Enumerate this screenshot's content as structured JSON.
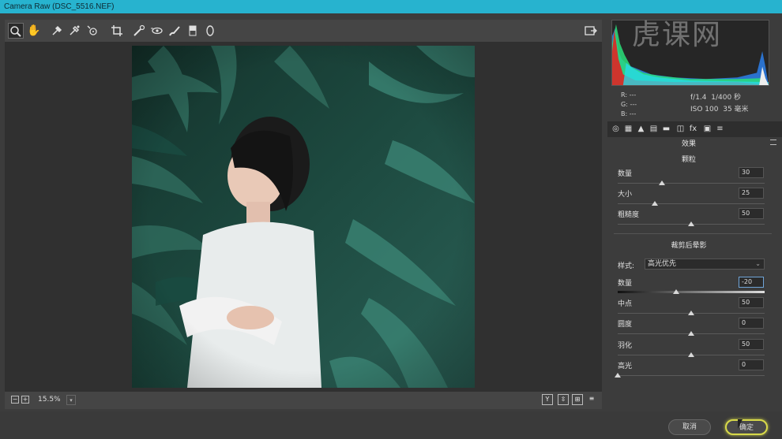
{
  "window": {
    "title": "Camera Raw (DSC_5516.NEF)"
  },
  "toolbar": {
    "tools": [
      "zoom-icon",
      "hand-icon",
      "white-balance-icon",
      "color-sampler-icon",
      "target-adjust-icon",
      "crop-icon",
      "spot-removal-icon",
      "red-eye-icon",
      "adjustment-brush-icon",
      "graduated-filter-icon",
      "radial-filter-icon"
    ],
    "right_tool": "open-preferences-icon"
  },
  "bottom": {
    "zoom_minus": "−",
    "zoom_plus": "+",
    "zoom": "15.5%"
  },
  "view_buttons": [
    "Y",
    "⇳",
    "⊞",
    "≡"
  ],
  "info": {
    "r_label": "R:",
    "g_label": "G:",
    "b_label": "B:",
    "r_val": "---",
    "g_val": "---",
    "b_val": "---",
    "aperture": "f/1.4",
    "shutter": "1/400 秒",
    "iso": "ISO 100",
    "focal": "35 毫米"
  },
  "panel": {
    "section_title": "效果",
    "grain": {
      "title": "颗粒",
      "sliders": [
        {
          "label": "数量",
          "value": "30",
          "pos": 0.3
        },
        {
          "label": "大小",
          "value": "25",
          "pos": 0.25
        },
        {
          "label": "粗糙度",
          "value": "50",
          "pos": 0.5
        }
      ]
    },
    "vignette": {
      "title": "裁剪后晕影",
      "style_label": "样式:",
      "style_value": "高光优先",
      "sliders": [
        {
          "label": "数量",
          "value": "-20",
          "pos": 0.4
        },
        {
          "label": "中点",
          "value": "50",
          "pos": 0.5
        },
        {
          "label": "圆度",
          "value": "0",
          "pos": 0.5
        },
        {
          "label": "羽化",
          "value": "50",
          "pos": 0.5
        },
        {
          "label": "高光",
          "value": "0",
          "pos": 0.0
        }
      ]
    }
  },
  "footer": {
    "cancel": "取消",
    "ok": "确定"
  },
  "watermark": "虎课网"
}
